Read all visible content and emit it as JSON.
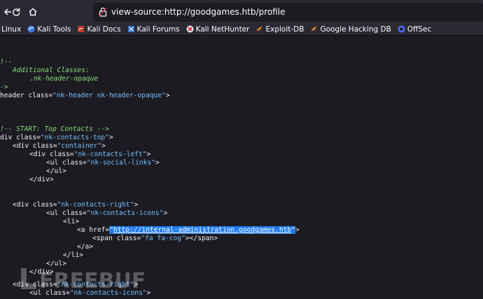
{
  "toolbar": {
    "url": "view-source:http://goodgames.htb/profile"
  },
  "bookmarks": [
    {
      "label": "Linux",
      "icon": "kali-icon"
    },
    {
      "label": "Kali Tools",
      "icon": "kali-icon"
    },
    {
      "label": "Kali Docs",
      "icon": "kali-docs-icon"
    },
    {
      "label": "Kali Forums",
      "icon": "kali-forums-icon"
    },
    {
      "label": "Kali NetHunter",
      "icon": "nethunter-icon"
    },
    {
      "label": "Exploit-DB",
      "icon": "exploit-db-icon"
    },
    {
      "label": "Google Hacking DB",
      "icon": "exploit-db-icon"
    },
    {
      "label": "OffSec",
      "icon": "offsec-icon"
    }
  ],
  "source": {
    "l1": "!--",
    "l2": "Additional Classes:",
    "l3": ".nk-header-opaque",
    "l4": "->",
    "l5_tag": "header",
    "l5_attr": "class",
    "l5_val": "\"nk-header nk-header-opaque\"",
    "l6": "!-- START: Top Contacts -->",
    "l7_tag": "div",
    "l7_val": "\"nk-contacts-top\"",
    "l8_val": "\"container\"",
    "l9_val": "\"nk-contacts-left\"",
    "l10_val": "\"nk-social-links\"",
    "l11": "</ul>",
    "l12": "</div>",
    "l13_val": "\"nk-contacts-right\"",
    "l14_val": "\"nk-contacts-icons\"",
    "l15": "<li>",
    "l16_attr": "href",
    "l16_link": "http://internal-administration.goodgames.htb",
    "l17_val": "\"fa fa-cog\"",
    "l18": "</a>",
    "l19": "</li>",
    "l20": "</ul>",
    "l21": "</div>",
    "l22_val": "\"nk-contacts-right\"",
    "l23_val": "\"nk-contacts-icons\"",
    "attr_class": "class"
  },
  "watermark": {
    "text": "FREEBUF"
  }
}
